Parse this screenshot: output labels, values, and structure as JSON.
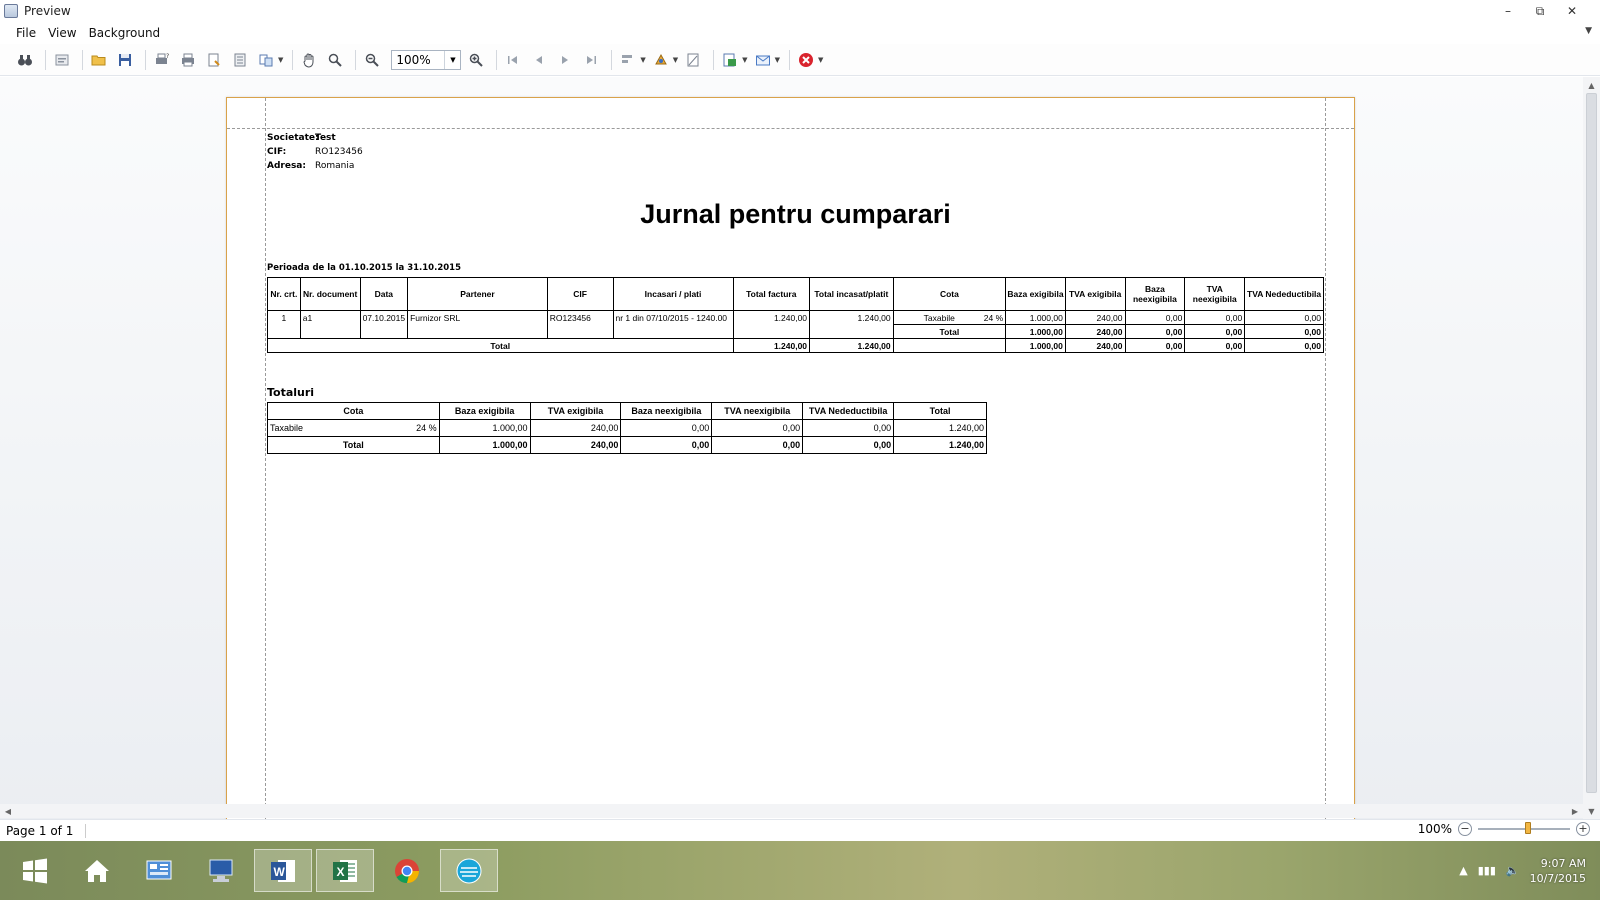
{
  "window": {
    "title": "Preview"
  },
  "menu": [
    "File",
    "View",
    "Background"
  ],
  "toolbar": {
    "zoom_value": "100%"
  },
  "company": {
    "societate_label": "Societate:",
    "societate": "Test",
    "cif_label": "CIF:",
    "cif": "RO123456",
    "adresa_label": "Adresa:",
    "adresa": "Romania"
  },
  "report": {
    "title": "Jurnal pentru cumparari",
    "period": "Perioada de la 01.10.2015 la 31.10.2015"
  },
  "journal": {
    "headers": [
      "Nr. crt.",
      "Nr. document",
      "Data",
      "Partener",
      "CIF",
      "Incasari / plati",
      "Total factura",
      "Total incasat/platit",
      "Cota",
      "Baza exigibila",
      "TVA exigibila",
      "Baza neexigibila",
      "TVA neexigibila",
      "TVA Nedeductibila"
    ],
    "row": {
      "nr": "1",
      "doc": "a1",
      "data": "07.10.2015",
      "partener": "Furnizor SRL",
      "cif": "RO123456",
      "incasari": "nr 1 din 07/10/2015 - 1240.00",
      "total_factura": "1.240,00",
      "total_incasat": "1.240,00",
      "cota_name": "Taxabile",
      "cota_pct": "24 %",
      "baza_ex": "1.000,00",
      "tva_ex": "240,00",
      "baza_neex": "0,00",
      "tva_neex": "0,00",
      "tva_ned": "0,00"
    },
    "cota_total": {
      "label": "Total",
      "baza_ex": "1.000,00",
      "tva_ex": "240,00",
      "baza_neex": "0,00",
      "tva_neex": "0,00",
      "tva_ned": "0,00"
    },
    "total": {
      "label": "Total",
      "total_factura": "1.240,00",
      "total_incasat": "1.240,00",
      "baza_ex": "1.000,00",
      "tva_ex": "240,00",
      "baza_neex": "0,00",
      "tva_neex": "0,00",
      "tva_ned": "0,00"
    }
  },
  "totaluri": {
    "title": "Totaluri",
    "headers": [
      "Cota",
      "Baza exigibila",
      "TVA exigibila",
      "Baza neexigibila",
      "TVA neexigibila",
      "TVA Nedeductibila",
      "Total"
    ],
    "row": {
      "cota_name": "Taxabile",
      "cota_pct": "24 %",
      "baza_ex": "1.000,00",
      "tva_ex": "240,00",
      "baza_neex": "0,00",
      "tva_neex": "0,00",
      "tva_ned": "0,00",
      "total": "1.240,00"
    },
    "total": {
      "label": "Total",
      "baza_ex": "1.000,00",
      "tva_ex": "240,00",
      "baza_neex": "0,00",
      "tva_neex": "0,00",
      "tva_ned": "0,00",
      "total": "1.240,00"
    }
  },
  "status": {
    "page_info": "Page 1 of 1",
    "zoom": "100%",
    "zoom_fraction": 0.55
  },
  "tray": {
    "time": "9:07 AM",
    "date": "10/7/2015"
  }
}
